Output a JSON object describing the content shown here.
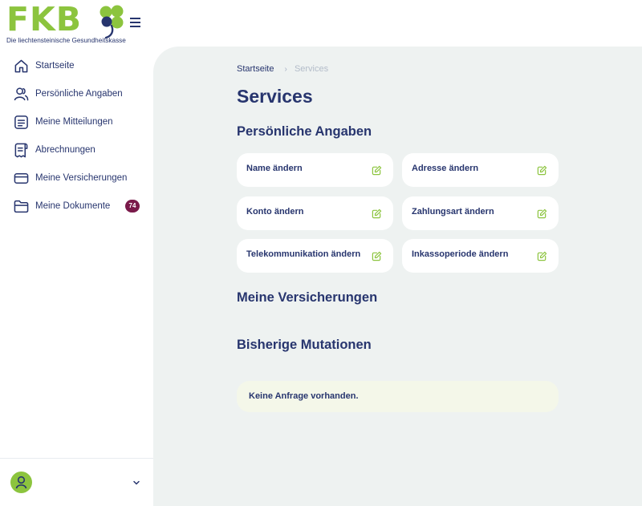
{
  "brand": {
    "logo_text": "FKB",
    "tagline": "Die liechtensteinische Gesundheitskasse",
    "green": "#8cc43e",
    "navy": "#27356e"
  },
  "header": {
    "menu_icon": "hamburger-menu-icon"
  },
  "sidebar": {
    "items": [
      {
        "label": "Startseite",
        "icon": "home-icon"
      },
      {
        "label": "Persönliche Angaben",
        "icon": "user-icon"
      },
      {
        "label": "Meine Mitteilungen",
        "icon": "message-icon"
      },
      {
        "label": "Abrechnungen",
        "icon": "receipt-icon"
      },
      {
        "label": "Meine Versicherungen",
        "icon": "card-icon"
      },
      {
        "label": "Meine Dokumente",
        "icon": "folder-icon",
        "badge": "74"
      }
    ],
    "badge_color": "#7a1a4a"
  },
  "breadcrumb": {
    "home": "Startseite",
    "separator": "›",
    "current": "Services"
  },
  "page": {
    "title": "Services",
    "sections": {
      "personal": "Persönliche Angaben",
      "insurance": "Meine Versicherungen",
      "mutations": "Bisherige Mutationen"
    },
    "cards": [
      {
        "label": "Name ändern"
      },
      {
        "label": "Adresse ändern"
      },
      {
        "label": "Konto ändern"
      },
      {
        "label": "Zahlungsart ändern"
      },
      {
        "label": "Telekommunikation ändern"
      },
      {
        "label": "Inkassoperiode ändern"
      }
    ],
    "notice": "Keine Anfrage vorhanden."
  }
}
